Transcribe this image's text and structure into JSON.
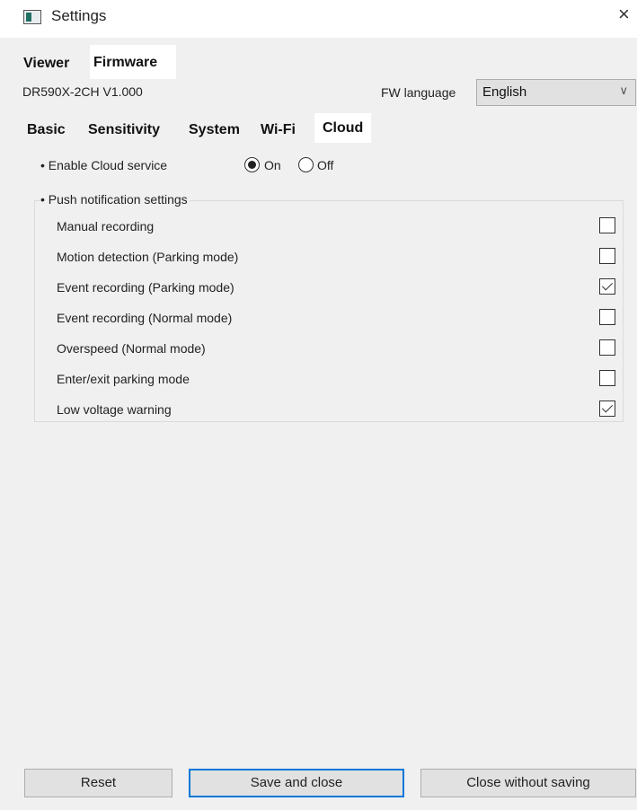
{
  "window": {
    "title": "Settings",
    "close_symbol": "×",
    "app_icon": "app-window-icon"
  },
  "top_tabs": [
    {
      "label": "Viewer",
      "active": false
    },
    {
      "label": "Firmware",
      "active": true
    }
  ],
  "firmware": {
    "model_version": "DR590X-2CH  V1.000",
    "fw_language_label": "FW language",
    "fw_language_value": "English"
  },
  "sub_tabs": [
    {
      "label": "Basic",
      "active": false
    },
    {
      "label": "Sensitivity",
      "active": false
    },
    {
      "label": "System",
      "active": false
    },
    {
      "label": "Wi-Fi",
      "active": false
    },
    {
      "label": "Cloud",
      "active": true
    }
  ],
  "cloud": {
    "enable_label": "• Enable Cloud service",
    "on_label": "On",
    "off_label": "Off",
    "selected": "On",
    "push_label": "• Push notification settings",
    "notifications": [
      {
        "label": "Manual recording",
        "checked": false
      },
      {
        "label": "Motion detection (Parking mode)",
        "checked": false
      },
      {
        "label": "Event recording (Parking mode)",
        "checked": true
      },
      {
        "label": "Event recording (Normal mode)",
        "checked": false
      },
      {
        "label": "Overspeed (Normal mode)",
        "checked": false
      },
      {
        "label": "Enter/exit parking mode",
        "checked": false
      },
      {
        "label": "Low voltage warning",
        "checked": true
      }
    ]
  },
  "buttons": {
    "reset": "Reset",
    "save_close": "Save and close",
    "close_no_save": "Close without saving"
  },
  "colors": {
    "focus_border": "#0078d7",
    "window_bg": "#f0f0f0",
    "button_bg": "#e1e1e1"
  }
}
